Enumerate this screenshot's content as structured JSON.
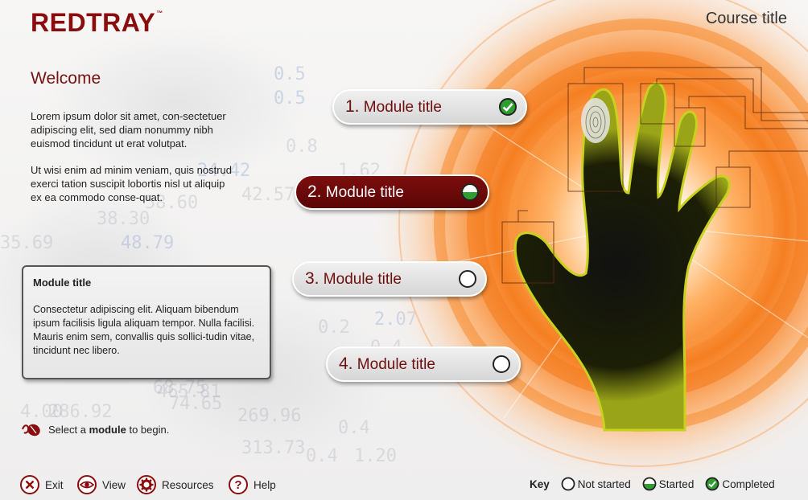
{
  "header": {
    "logo_text": "REDTRAY",
    "logo_tm": "™",
    "course_title": "Course title"
  },
  "intro": {
    "heading": "Welcome",
    "paragraph1": "Lorem ipsum dolor sit amet, con-sectetuer adipiscing elit, sed diam nonummy nibh euismod tincidunt ut erat volutpat.",
    "paragraph2": "Ut wisi enim ad minim veniam, quis nostrud exerci tation suscipit lobortis nisl ut aliquip ex ea commodo conse-quat."
  },
  "info_box": {
    "title": "Module title",
    "text": "Consectetur adipiscing elit. Aliquam bibendum ipsum facilisis ligula aliquam tempor. Nulla facilisi. Mauris enim sem, convallis quis sollici-tudin vitae, tincidunt nec libero."
  },
  "hint": {
    "prefix": "Select a",
    "bold": "module",
    "suffix": "to begin."
  },
  "modules": [
    {
      "number": "1.",
      "label": "Module title",
      "status": "completed"
    },
    {
      "number": "2.",
      "label": "Module title",
      "status": "started"
    },
    {
      "number": "3.",
      "label": "Module title",
      "status": "not-started"
    },
    {
      "number": "4.",
      "label": "Module title",
      "status": "not-started"
    }
  ],
  "footer": {
    "exit": "Exit",
    "view": "View",
    "resources": "Resources",
    "help": "Help",
    "icons": [
      "close-icon",
      "eye-icon",
      "gear-icon",
      "question-icon"
    ]
  },
  "key": {
    "title": "Key",
    "not_started": "Not started",
    "started": "Started",
    "completed": "Completed"
  },
  "background_numbers": [
    "0.5",
    "0.5",
    "0.8",
    "24.42",
    "58.60",
    "42.57",
    "1.62",
    "38.30",
    "48.79",
    "35.69",
    "2.07",
    "0.4",
    "0.2",
    "4.07",
    "4.00",
    "68.75",
    "74.65",
    "465.81",
    "286.92",
    "0.4",
    "269.96",
    "313.73",
    "1.20",
    "0.4"
  ],
  "colors": {
    "brand": "#8b0c0c",
    "accent_orange": "#f7862c",
    "completed_green": "#2e9e2e"
  }
}
